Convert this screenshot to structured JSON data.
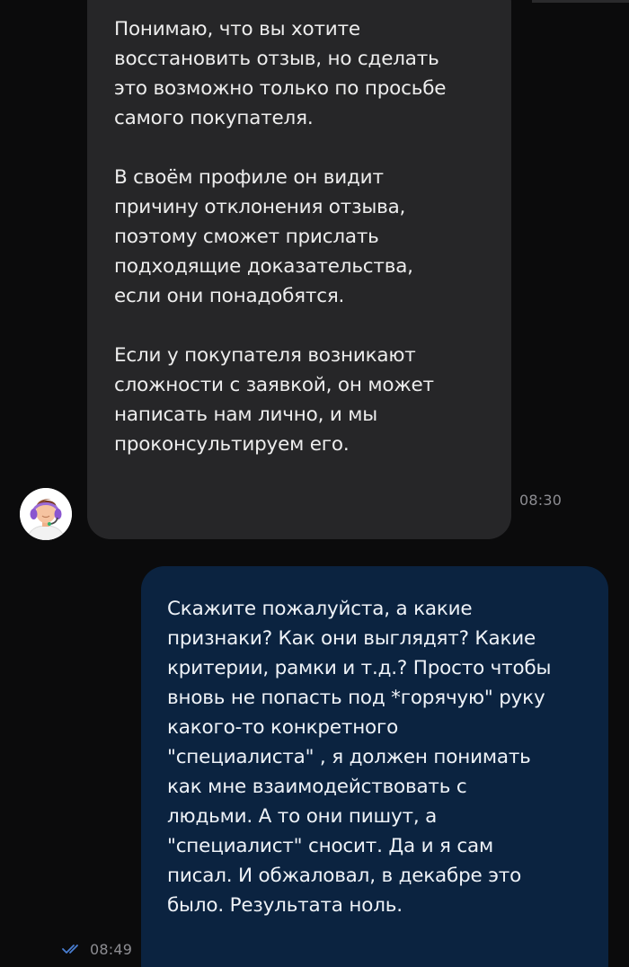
{
  "chat": {
    "incoming": {
      "text": "Понимаю, что вы хотите\nвосстановить отзыв, но сделать\nэто возможно только по просьбе\nсамого покупателя.\n\nВ своём профиле он видит\nпричину отклонения отзыва,\nпоэтому сможет прислать\nподходящие доказательства,\nесли они понадобятся.\n\nЕсли у покупателя возникают\nсложности с заявкой, он может\nнаписать нам лично, и мы\nпроконсультируем его.",
      "time": "08:30",
      "avatar_icon": "support-agent-headset-icon"
    },
    "outgoing": {
      "text": "Скажите пожалуйста, а какие\nпризнаки? Как они выглядят? Какие\nкритерии, рамки и т.д.? Просто чтобы\nвновь не попасть под *горячую\" руку\nкакого-то конкретного\n\"специалиста\" , я должен понимать\nкак мне взаимодействовать с\nлюдьми. А то они пишут, а\n\"специалист\" сносит. Да и я сам\nписал. И обжаловал, в декабре это\nбыло. Результата ноль.",
      "time": "08:49",
      "status_icon": "double-check-read-icon"
    }
  },
  "colors": {
    "background": "#0b0b0c",
    "incoming_bubble": "#262628",
    "outgoing_bubble": "#0b2340",
    "timestamp": "#8d8d92",
    "read_ticks": "#4a7fd4"
  }
}
